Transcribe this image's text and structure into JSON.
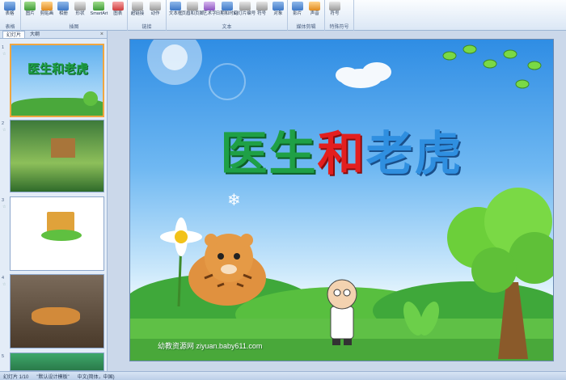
{
  "ribbon": {
    "groups": [
      {
        "label": "表格",
        "buttons": [
          {
            "label": "表格",
            "icon": "table-icon"
          }
        ]
      },
      {
        "label": "插图",
        "buttons": [
          {
            "label": "图片",
            "icon": "picture-icon"
          },
          {
            "label": "剪贴画",
            "icon": "clipart-icon"
          },
          {
            "label": "相册",
            "icon": "album-icon"
          },
          {
            "label": "形状",
            "icon": "shapes-icon"
          },
          {
            "label": "SmartArt",
            "icon": "smartart-icon"
          },
          {
            "label": "图表",
            "icon": "chart-icon"
          }
        ]
      },
      {
        "label": "链接",
        "buttons": [
          {
            "label": "超链接",
            "icon": "hyperlink-icon"
          },
          {
            "label": "动作",
            "icon": "action-icon"
          }
        ]
      },
      {
        "label": "文本",
        "buttons": [
          {
            "label": "文本框",
            "icon": "textbox-icon"
          },
          {
            "label": "页眉和页脚",
            "icon": "header-footer-icon"
          },
          {
            "label": "艺术字",
            "icon": "wordart-icon"
          },
          {
            "label": "日期和时间",
            "icon": "date-time-icon"
          },
          {
            "label": "幻灯片编号",
            "icon": "slide-number-icon"
          },
          {
            "label": "符号",
            "icon": "symbol-icon"
          },
          {
            "label": "对象",
            "icon": "object-icon"
          }
        ]
      },
      {
        "label": "媒体剪辑",
        "buttons": [
          {
            "label": "影片",
            "icon": "movie-icon"
          },
          {
            "label": "声音",
            "icon": "sound-icon"
          }
        ]
      },
      {
        "label": "特殊符号",
        "buttons": [
          {
            "label": "符号",
            "icon": "symbol-icon"
          }
        ]
      }
    ]
  },
  "left_panel": {
    "tabs": [
      "幻灯片",
      "大纲"
    ],
    "close": "×",
    "slides": [
      {
        "num": "1",
        "title": "医生和老虎"
      },
      {
        "num": "2"
      },
      {
        "num": "3"
      },
      {
        "num": "4"
      },
      {
        "num": "5"
      }
    ]
  },
  "slide": {
    "title_chars": [
      "医",
      "生",
      "和",
      "老",
      "虎"
    ],
    "watermark": "幼教资源网 ziyuan.baby611.com"
  },
  "status": {
    "slide_count": "幻灯片 1/10",
    "theme": "\"默认设计模板\"",
    "language": "中文(简体，中国)"
  },
  "colors": {
    "title_green": "#1fa046",
    "title_red": "#e31f1f",
    "title_blue": "#2f8fe0",
    "active_thumb_border": "#f0a640"
  }
}
